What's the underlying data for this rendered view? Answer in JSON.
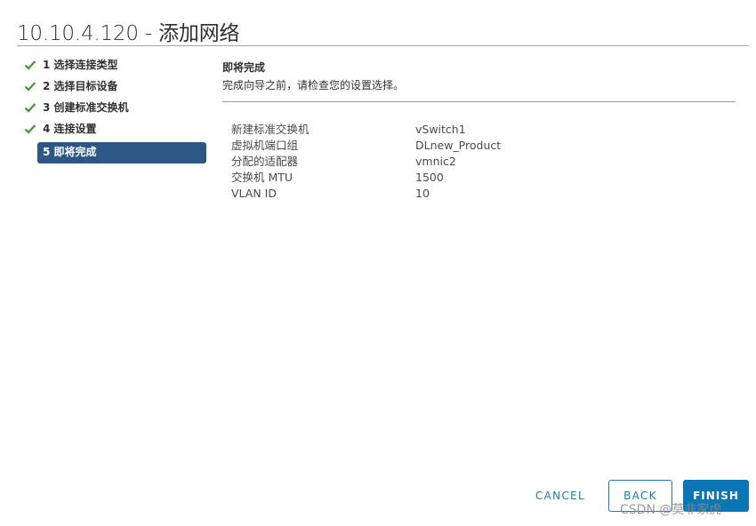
{
  "window": {
    "title": "10.10.4.120 - 添加网络"
  },
  "steps": [
    {
      "label": "1 选择连接类型",
      "state": "done"
    },
    {
      "label": "2 选择目标设备",
      "state": "done"
    },
    {
      "label": "3 创建标准交换机",
      "state": "done"
    },
    {
      "label": "4 连接设置",
      "state": "done"
    },
    {
      "label": "5 即将完成",
      "state": "active"
    }
  ],
  "summary": {
    "title": "即将完成",
    "description": "完成向导之前，请检查您的设置选择。",
    "rows": [
      {
        "key": "新建标准交换机",
        "value": "vSwitch1"
      },
      {
        "key": "虚拟机端口组",
        "value": "DLnew_Product"
      },
      {
        "key": "分配的适配器",
        "value": "vmnic2"
      },
      {
        "key": "交换机 MTU",
        "value": "1500"
      },
      {
        "key": "VLAN ID",
        "value": "10"
      }
    ]
  },
  "buttons": {
    "cancel": "CANCEL",
    "back": "BACK",
    "finish": "FINISH"
  },
  "watermark": "CSDN @莫非家虎",
  "colors": {
    "accent": "#0b76b5",
    "active_step": "#2d5784",
    "check": "#3c9a2f"
  }
}
